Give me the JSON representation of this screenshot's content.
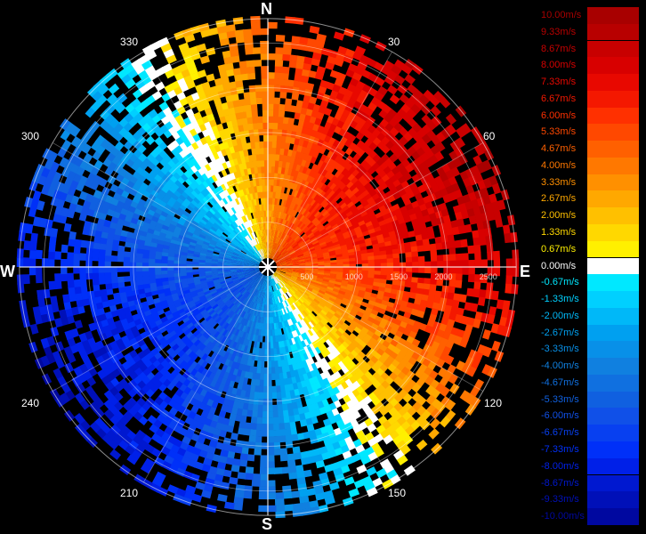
{
  "compass": {
    "north": "N",
    "south": "S",
    "east": "E",
    "west": "W"
  },
  "bearings": [
    "30",
    "60",
    "120",
    "150",
    "210",
    "240",
    "300",
    "330"
  ],
  "range_rings": [
    "500",
    "1000",
    "1500",
    "2000",
    "2500"
  ],
  "legend": {
    "entries": [
      {
        "label": "10.00m/s",
        "color": "#a80000"
      },
      {
        "label": "9.33m/s",
        "color": "#b80000"
      },
      {
        "label": "8.67m/s",
        "color": "#c80000"
      },
      {
        "label": "8.00m/s",
        "color": "#d80000"
      },
      {
        "label": "7.33m/s",
        "color": "#e80800"
      },
      {
        "label": "6.67m/s",
        "color": "#f41800"
      },
      {
        "label": "6.00m/s",
        "color": "#ff3000"
      },
      {
        "label": "5.33m/s",
        "color": "#ff4800"
      },
      {
        "label": "4.67m/s",
        "color": "#ff6000"
      },
      {
        "label": "4.00m/s",
        "color": "#ff7800"
      },
      {
        "label": "3.33m/s",
        "color": "#ff9000"
      },
      {
        "label": "2.67m/s",
        "color": "#ffa800"
      },
      {
        "label": "2.00m/s",
        "color": "#ffc000"
      },
      {
        "label": "1.33m/s",
        "color": "#ffd800"
      },
      {
        "label": "0.67m/s",
        "color": "#fff000"
      },
      {
        "label": "0.00m/s",
        "color": "#ffffff"
      },
      {
        "label": "-0.67m/s",
        "color": "#00e8ff"
      },
      {
        "label": "-1.33m/s",
        "color": "#00d0ff"
      },
      {
        "label": "-2.00m/s",
        "color": "#00b8f8"
      },
      {
        "label": "-2.67m/s",
        "color": "#00a0f0"
      },
      {
        "label": "-3.33m/s",
        "color": "#0890e8"
      },
      {
        "label": "-4.00m/s",
        "color": "#1080e0"
      },
      {
        "label": "-4.67m/s",
        "color": "#1070e0"
      },
      {
        "label": "-5.33m/s",
        "color": "#1060e0"
      },
      {
        "label": "-6.00m/s",
        "color": "#1050e8"
      },
      {
        "label": "-6.67m/s",
        "color": "#0840f0"
      },
      {
        "label": "-7.33m/s",
        "color": "#0030f8"
      },
      {
        "label": "-8.00m/s",
        "color": "#0020e8"
      },
      {
        "label": "-8.67m/s",
        "color": "#0018d0"
      },
      {
        "label": "-9.33m/s",
        "color": "#0010b8"
      },
      {
        "label": "-10.00m/s",
        "color": "#0008a0"
      }
    ]
  }
}
